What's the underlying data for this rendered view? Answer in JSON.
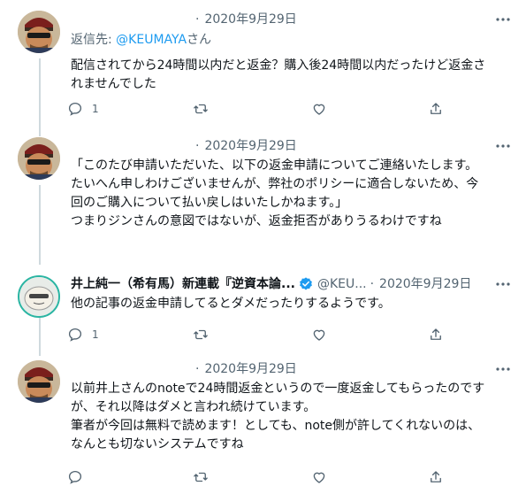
{
  "tweets": [
    {
      "date": "2020年9月29日",
      "reply_prefix": "返信先: ",
      "reply_mention": "@KEUMAYA",
      "reply_suffix": "さん",
      "lines": [
        "配信されてから24時間以内だと返金？購入後24時間以内だったけど返金さ",
        "れませんでした"
      ],
      "reply_count": "1"
    },
    {
      "date": "2020年9月29日",
      "lines": [
        "「このたび申請いただいた、以下の返金申請についてご連絡いたします。",
        "たいへん申しわけございませんが、弊社のポリシーに適合しないため、今",
        "回のご購入について払い戻しはいたしかねます。」",
        "つまりジンさんの意図ではないが、返金拒否がありうるわけですね"
      ],
      "reply_count": "1"
    },
    {
      "name": "井上純一（希有馬）新連載『逆資本論...",
      "handle": "@KEU...",
      "date": "2020年9月29日",
      "lines": [
        "他の記事の返金申請してるとダメだったりするようです。"
      ],
      "reply_count": "1"
    },
    {
      "date": "2020年9月29日",
      "lines": [
        "以前井上さんのnoteで24時間返金というので一度返金してもらったのです",
        "が、それ以降はダメと言われ続けています。",
        "筆者が今回は無料で読めます！としても、note側が許してくれないのは、",
        "なんとも切ないシステムですね"
      ],
      "reply_count": ""
    }
  ],
  "header_separator": "·",
  "icons": {
    "reply": "reply-icon",
    "retweet": "retweet-icon",
    "like": "like-icon",
    "share": "share-icon",
    "more": "more-icon",
    "verified": "verified-badge-icon"
  },
  "colors": {
    "text": "#0f1419",
    "secondary": "#536471",
    "link": "#1d9bf0",
    "thread_line": "#cfd9de"
  }
}
